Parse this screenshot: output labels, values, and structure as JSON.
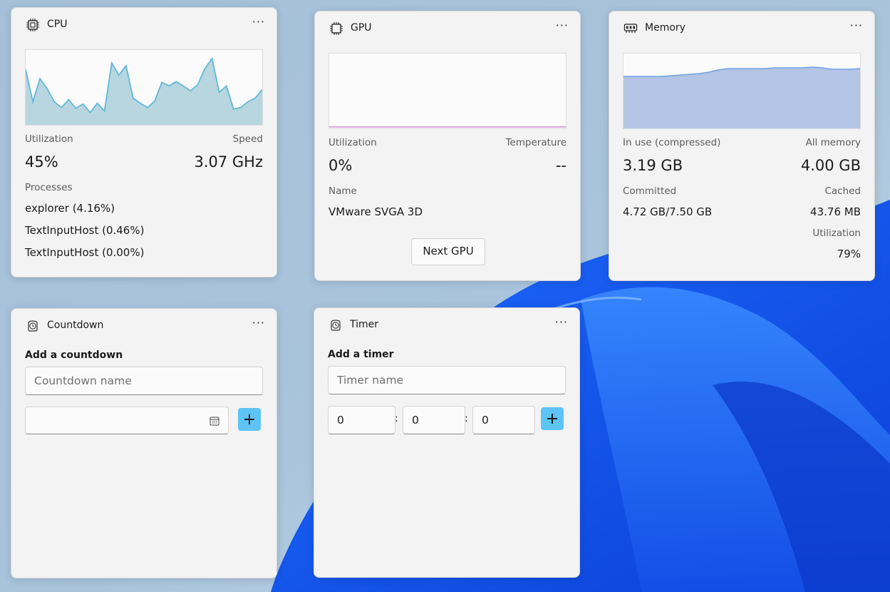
{
  "colors": {
    "accent": "#5ec3f5",
    "cpu_line": "#60b8d8",
    "cpu_fill": "#b7d6df",
    "gpu_line": "#d79ad9",
    "mem_line": "#7aa7e6",
    "mem_fill": "#b4c4e4"
  },
  "cpu": {
    "title": "CPU",
    "more": "···",
    "icon": "processor-chip-icon",
    "utilization_label": "Utilization",
    "speed_label": "Speed",
    "utilization": "45%",
    "speed": "3.07 GHz",
    "processes_label": "Processes",
    "processes": [
      "explorer (4.16%)",
      "TextInputHost (0.46%)",
      "TextInputHost (0.00%)"
    ]
  },
  "gpu": {
    "title": "GPU",
    "more": "···",
    "icon": "gpu-chip-icon",
    "utilization_label": "Utilization",
    "temperature_label": "Temperature",
    "utilization": "0%",
    "temperature": "--",
    "name_label": "Name",
    "name": "VMware SVGA 3D",
    "next_button": "Next GPU"
  },
  "memory": {
    "title": "Memory",
    "more": "···",
    "icon": "memory-module-icon",
    "in_use_label": "In use (compressed)",
    "all_memory_label": "All memory",
    "in_use": "3.19 GB",
    "all_memory": "4.00 GB",
    "committed_label": "Committed",
    "cached_label": "Cached",
    "committed": "4.72 GB/7.50 GB",
    "cached": "43.76 MB",
    "utilization_label": "Utilization",
    "utilization": "79%"
  },
  "countdown": {
    "title": "Countdown",
    "more": "···",
    "icon": "clock-icon",
    "section": "Add a countdown",
    "name_placeholder": "Countdown name",
    "date_value": ""
  },
  "timer": {
    "title": "Timer",
    "more": "···",
    "icon": "clock-icon",
    "section": "Add a timer",
    "name_placeholder": "Timer name",
    "hours": "0",
    "minutes": "0",
    "seconds": "0",
    "separator": ":"
  },
  "chart_data": [
    {
      "type": "area",
      "name": "cpu-utilization",
      "ylim": [
        0,
        100
      ],
      "values": [
        75,
        30,
        62,
        48,
        30,
        22,
        33,
        21,
        27,
        15,
        28,
        17,
        84,
        67,
        80,
        35,
        28,
        22,
        31,
        57,
        52,
        58,
        52,
        45,
        54,
        76,
        90,
        43,
        52,
        20,
        22,
        30,
        35,
        47
      ]
    },
    {
      "type": "line",
      "name": "gpu-utilization",
      "ylim": [
        0,
        100
      ],
      "values": [
        0,
        0,
        0,
        0,
        0,
        0,
        0,
        0,
        0,
        0,
        0,
        0
      ]
    },
    {
      "type": "area",
      "name": "memory-usage",
      "ylim": [
        0,
        100
      ],
      "values": [
        70,
        70,
        70,
        70,
        70,
        71,
        72,
        73,
        74,
        76,
        79,
        81,
        81,
        81,
        81,
        81,
        82,
        82,
        82,
        82,
        83,
        82,
        80,
        80,
        80,
        81
      ]
    }
  ]
}
